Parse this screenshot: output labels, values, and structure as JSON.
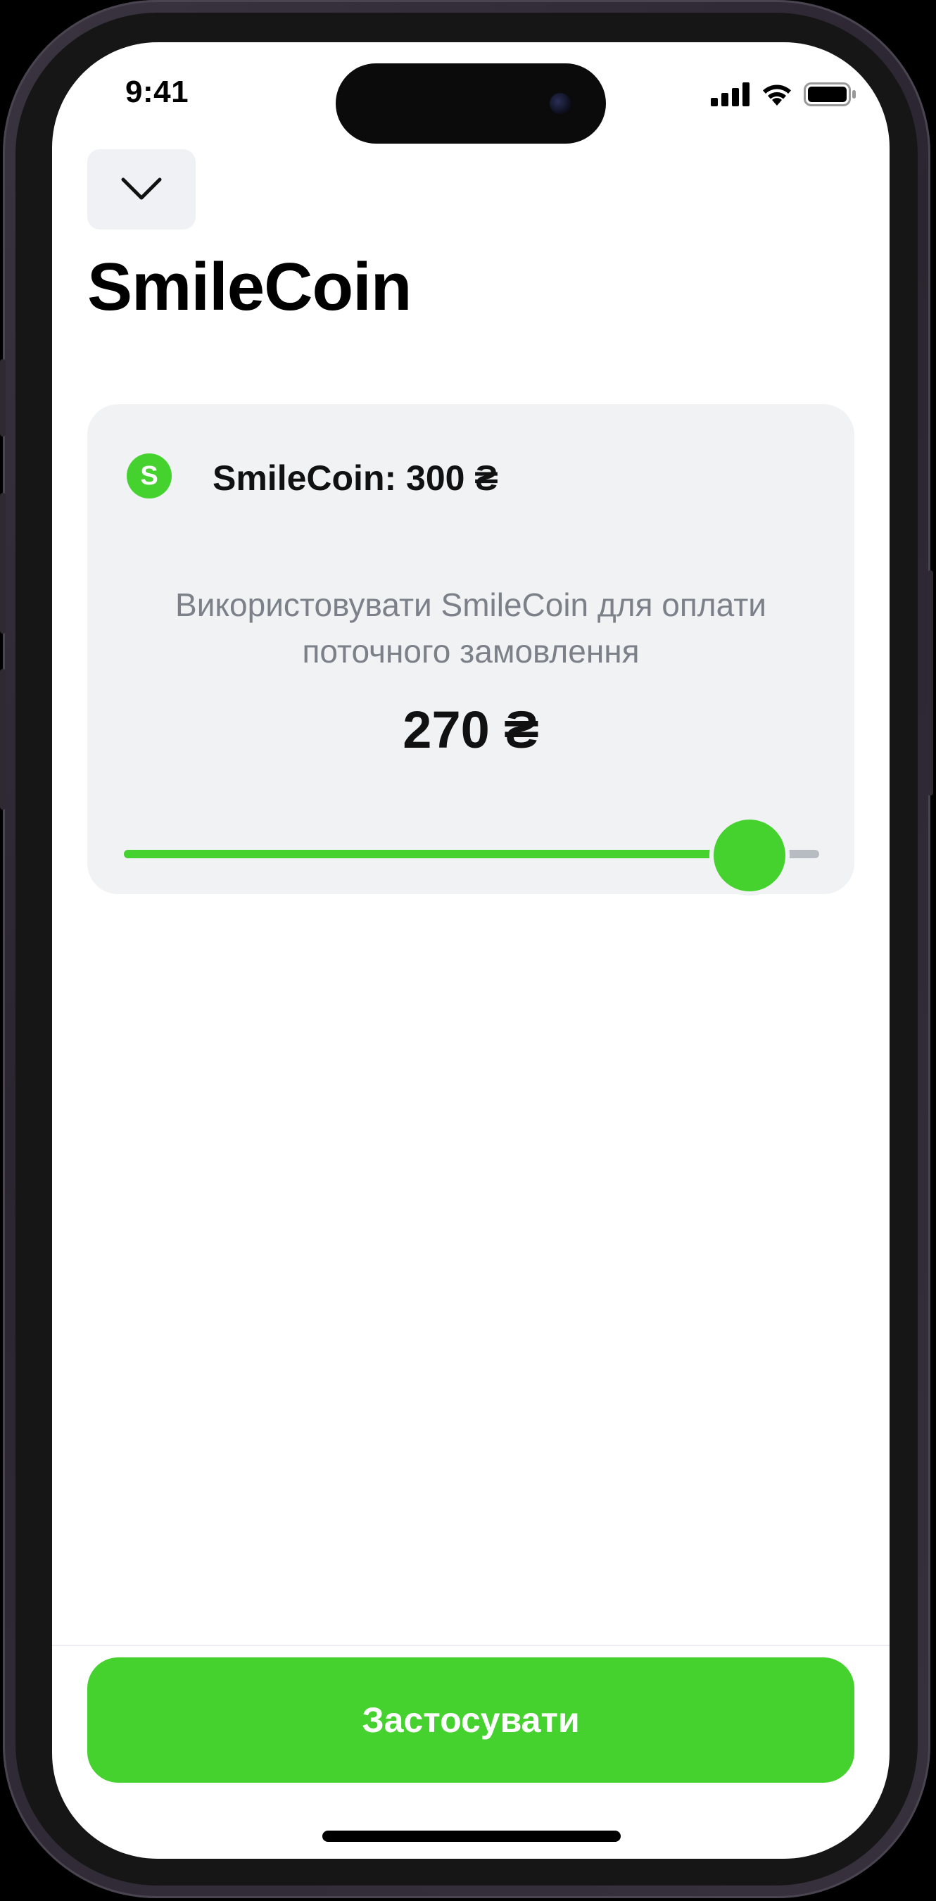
{
  "status_bar": {
    "time": "9:41",
    "icons": [
      "cellular-signal-icon",
      "wifi-icon",
      "battery-icon"
    ]
  },
  "header": {
    "collapse_icon": "chevron-down-icon",
    "title": "SmileCoin"
  },
  "card": {
    "coin_badge": "S",
    "balance_label": "SmileCoin: 300 ₴",
    "description": "Використовувати SmileCoin для оплати поточного замовлення",
    "selected_amount": "270 ₴",
    "slider": {
      "min": 0,
      "max": 300,
      "value": 270
    }
  },
  "footer": {
    "apply_label": "Застосувати"
  },
  "colors": {
    "accent": "#45d22f",
    "card_bg": "#f1f2f4",
    "track": "#b7bcc3",
    "muted_text": "#7c8088"
  }
}
